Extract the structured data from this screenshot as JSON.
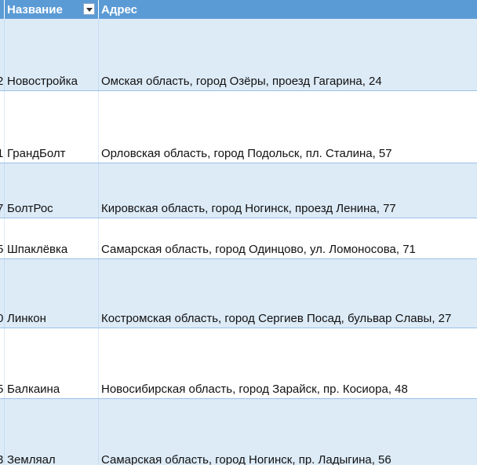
{
  "table": {
    "headers": {
      "name": "Название",
      "address": "Адрес"
    },
    "rows": [
      {
        "id_fragment": "2",
        "name": "Новостройка",
        "address": "Омская область, город Озёры, проезд Гагарина, 24"
      },
      {
        "id_fragment": "1",
        "name": "ГрандБолт",
        "address": "Орловская область, город Подольск, пл. Сталина, 57"
      },
      {
        "id_fragment": "7",
        "name": "БолтРос",
        "address": "Кировская область, город Ногинск, проезд Ленина, 77"
      },
      {
        "id_fragment": "5",
        "name": "Шпаклёвка",
        "address": "Самарская область, город Одинцово, ул. Ломоносова, 71"
      },
      {
        "id_fragment": "0",
        "name": "Линкон",
        "address": "Костромская область, город Сергиев Посад, бульвар Славы, 27"
      },
      {
        "id_fragment": "5",
        "name": "Балкаина",
        "address": "Новосибирская область, город Зарайск, пр. Косиора, 48"
      },
      {
        "id_fragment": "3",
        "name": "Земляал",
        "address": "Самарская область, город Ногинск, пр. Ладыгина, 56"
      }
    ]
  },
  "colors": {
    "header_bg": "#5b9bd5",
    "band_bg": "#ddebf7",
    "row_border": "#9bc2e6"
  }
}
